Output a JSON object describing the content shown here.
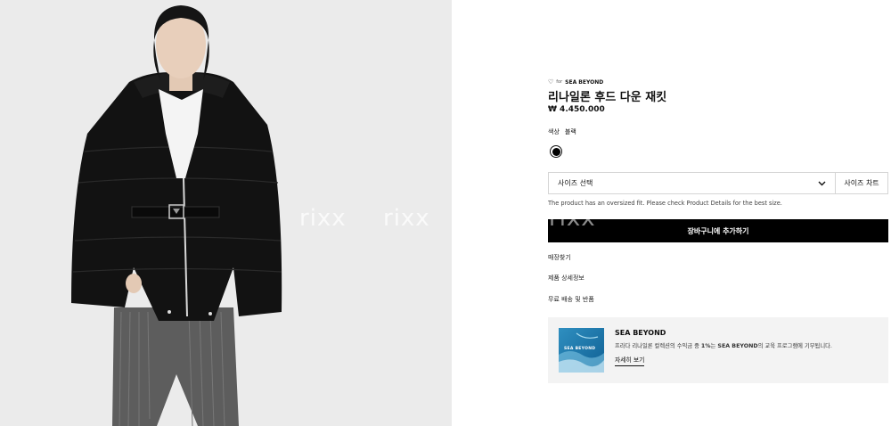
{
  "product": {
    "brand_for": "for",
    "brand_partner": "SEA BEYOND",
    "title": "리나일론 후드 다운 재킷",
    "price": "₩ 4.450.000",
    "color_label": "색상",
    "color_value": "블랙"
  },
  "size": {
    "select_label": "사이즈 선택",
    "chart_label": "사이즈 차트"
  },
  "fit_note": "The product has an oversized fit. Please check Product Details for the best size.",
  "cart": {
    "add_label": "장바구니에 추가하기"
  },
  "links": [
    "매장찾기",
    "제품 상세정보",
    "무료 배송 및 반품"
  ],
  "sea_beyond": {
    "title": "SEA BEYOND",
    "desc_prefix": "프라다 리나일론 컬렉션의 수익금 중 ",
    "desc_bold": "1%",
    "desc_mid": "는 ",
    "desc_bold2": "SEA BEYOND",
    "desc_suffix": "의 교육 프로그램에 기부됩니다.",
    "more_label": "자세히 보기",
    "thumb_label": "SEA BEYOND"
  },
  "watermarks": [
    "rixx",
    "rixx",
    "rixx"
  ],
  "colors": {
    "swatch_black": "#000000",
    "button_bg": "#000000",
    "card_bg": "#f3f3f3"
  }
}
